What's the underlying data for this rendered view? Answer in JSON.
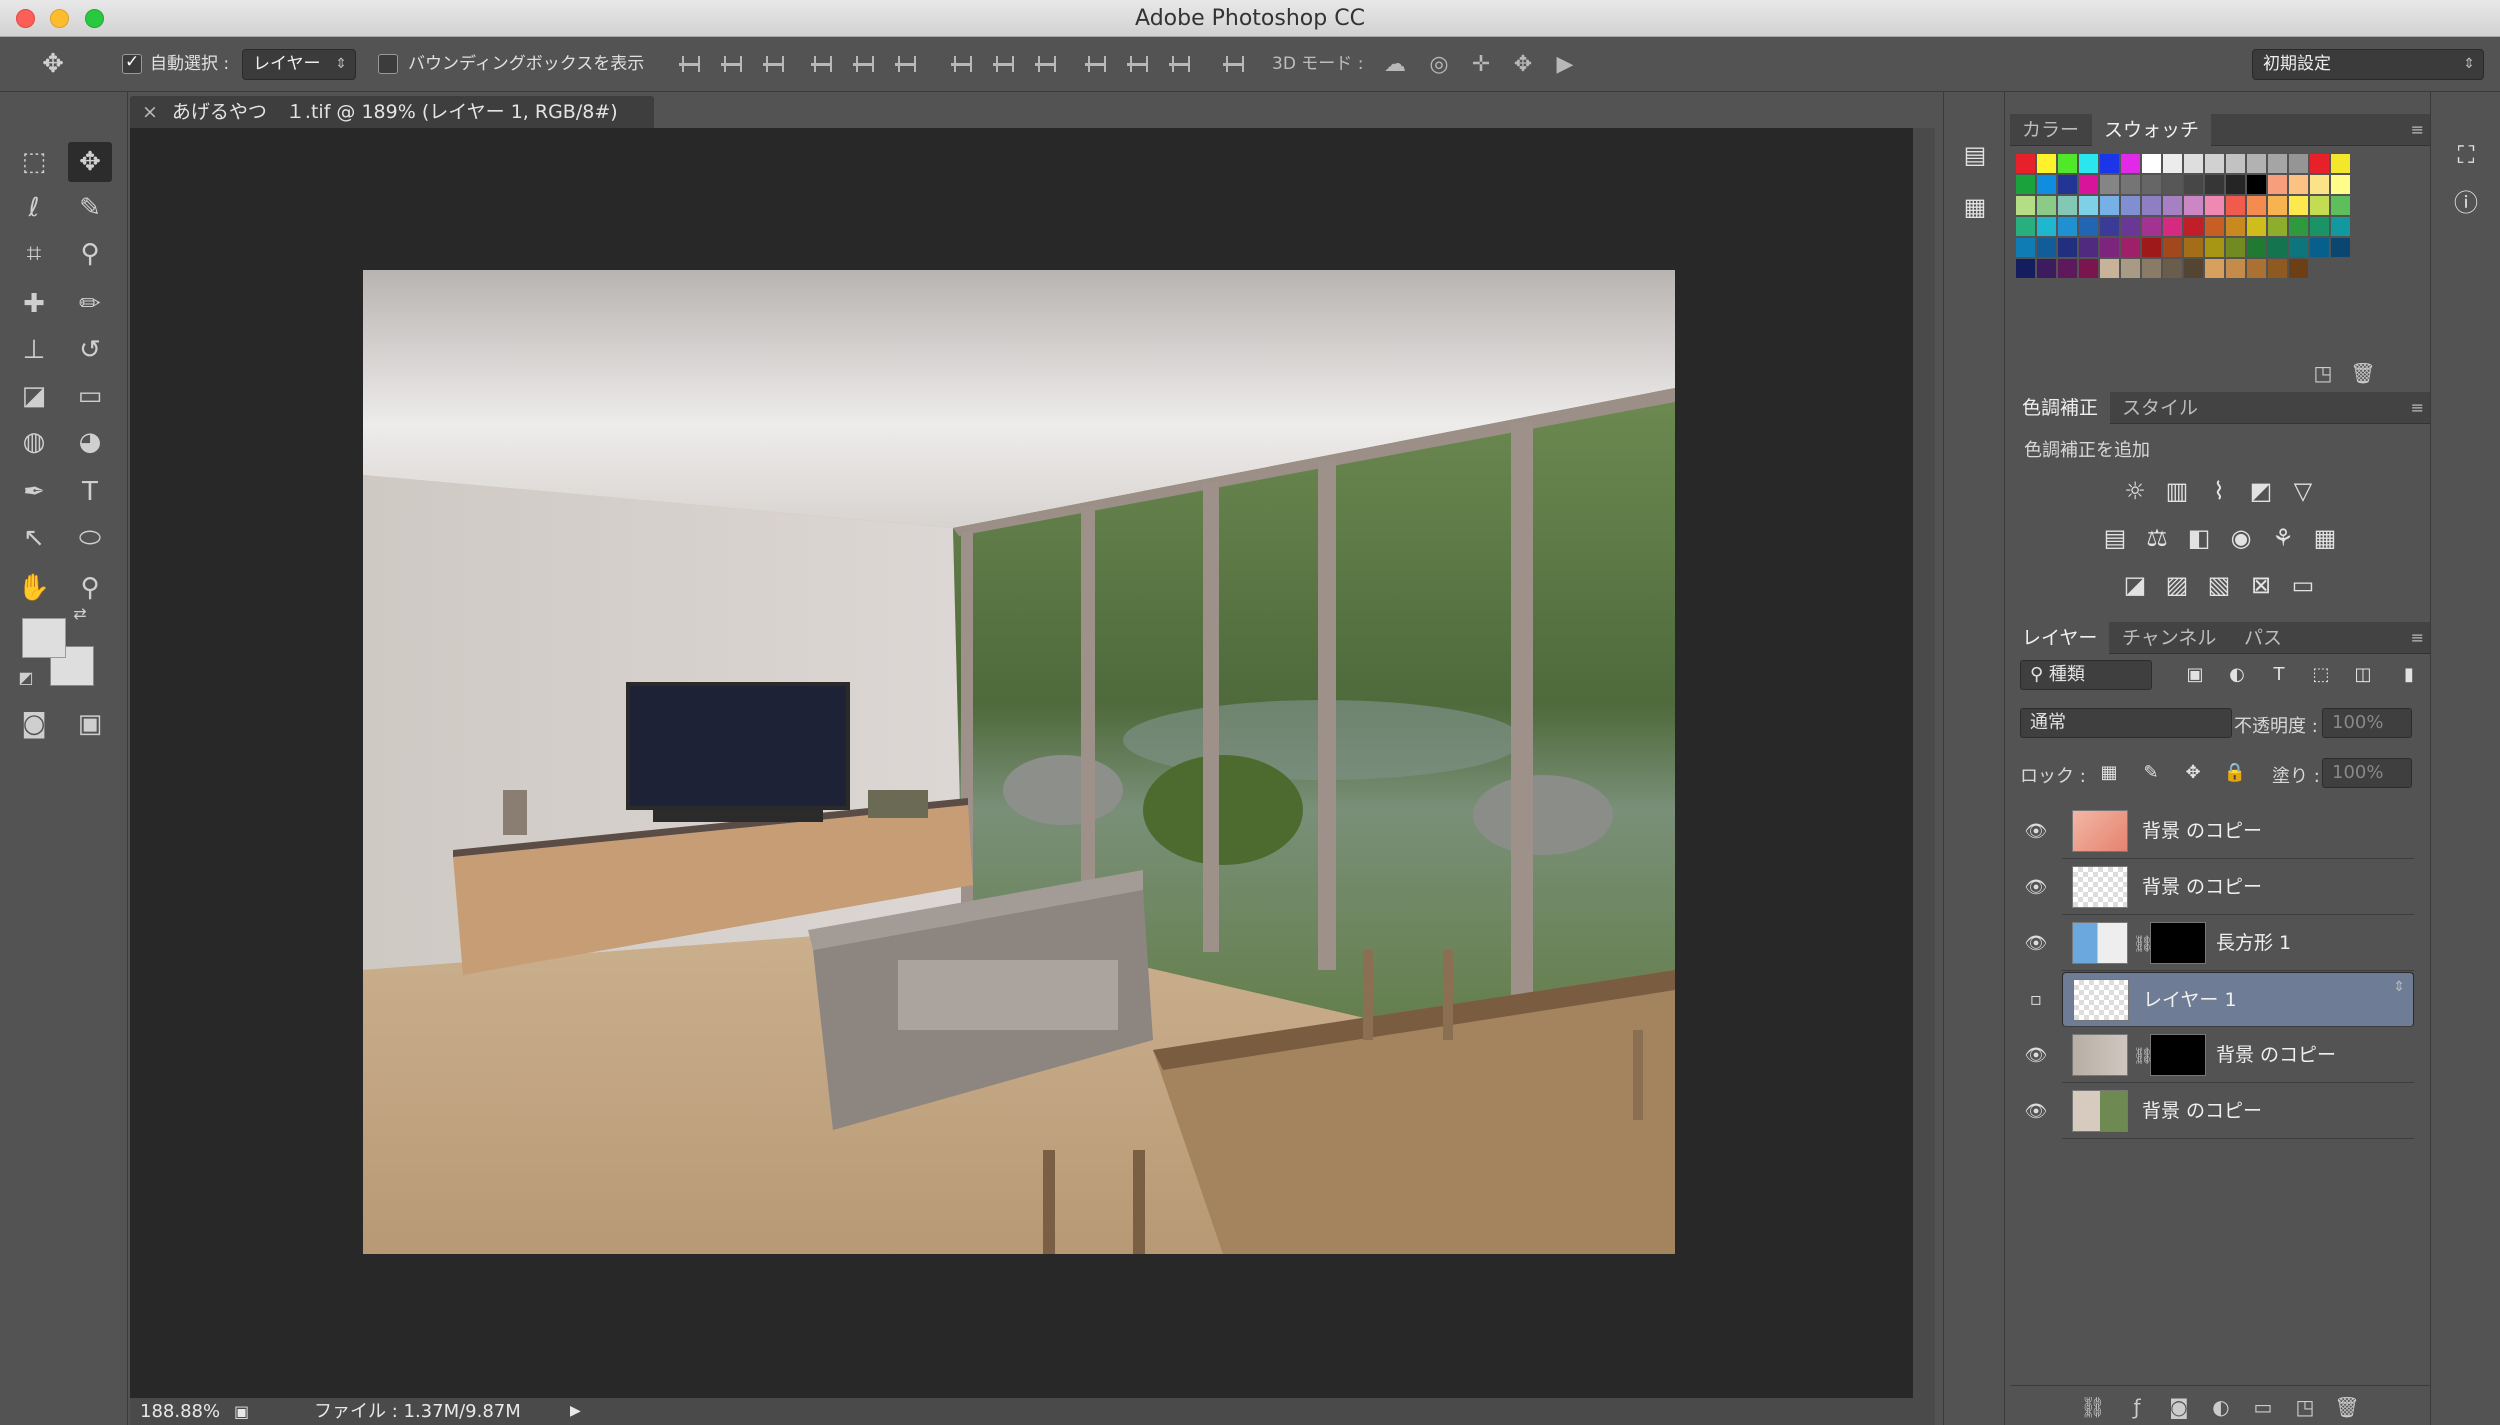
{
  "app": {
    "title": "Adobe Photoshop CC"
  },
  "options": {
    "auto_select_label": "自動選択 :",
    "auto_select_target": "レイヤー",
    "show_bbox_label": "バウンディングボックスを表示",
    "mode_3d_label": "3D モード :",
    "workspace": "初期設定"
  },
  "document": {
    "tab_title": "あげるやつ　１.tif @ 189% (レイヤー 1, RGB/8#)",
    "zoom": "188.88%",
    "file_info": "ファイル : 1.37M/9.87M"
  },
  "swatches_panel": {
    "tabs": [
      "カラー",
      "スウォッチ"
    ],
    "active": "スウォッチ",
    "colors": [
      [
        "#e8202a",
        "#fff22a",
        "#52e82a",
        "#29e6ef",
        "#1b36e8",
        "#e12ae8",
        "#ffffff",
        "#ececec",
        "#dedede",
        "#d1d1d1",
        "#c2c2c2",
        "#b2b2b2",
        "#a5a5a5",
        "#959595",
        "#e8202a",
        "#f3e62b"
      ],
      [
        "#1aa33c",
        "#0f8de0",
        "#223494",
        "#d8149a",
        "#858585",
        "#757575",
        "#666666",
        "#575757",
        "#474747",
        "#363636",
        "#252525",
        "#000000",
        "#f79e7c",
        "#fbc284",
        "#fde387",
        "#fffc89"
      ],
      [
        "#b4dd85",
        "#8bcb87",
        "#82c8b5",
        "#7ed0e6",
        "#77b0e6",
        "#7f8fd1",
        "#8e7ec2",
        "#a680c2",
        "#cc86c5",
        "#ef89b2",
        "#f05b4d",
        "#f58b4e",
        "#f6b34f",
        "#fbe94d",
        "#c2dd51",
        "#5fbe5c"
      ],
      [
        "#27b07d",
        "#1fb7d0",
        "#1f90d2",
        "#2265b2",
        "#3a3b97",
        "#6b3797",
        "#a33392",
        "#d62a80",
        "#c01e28",
        "#c75e23",
        "#c9891f",
        "#cfbd1b",
        "#8ead2c",
        "#2e9a3d",
        "#1a9467",
        "#12999f"
      ],
      [
        "#0f7cb3",
        "#135c9a",
        "#222f7e",
        "#4f2a7f",
        "#7d257c",
        "#a01f69",
        "#9e1a1a",
        "#a3481c",
        "#a46e18",
        "#a79613",
        "#728a22",
        "#207a31",
        "#13744f",
        "#0c767c",
        "#075f8b",
        "#0a466f"
      ],
      [
        "#141e5e",
        "#3c1c5e",
        "#5e185c",
        "#7a154d",
        "#c8b39a",
        "#a99a85",
        "#8a7b66",
        "#6b5d4b",
        "#544532",
        "#d7a05f",
        "#c58b4a",
        "#ab7133",
        "#8f5a22",
        "#6c4014"
      ]
    ]
  },
  "adjustments_panel": {
    "tabs": [
      "色調補正",
      "スタイル"
    ],
    "active": "色調補正",
    "heading": "色調補正を追加",
    "rows": [
      [
        "brightness-icon",
        "levels-icon",
        "curves-icon",
        "exposure-icon",
        "vibrance-icon"
      ],
      [
        "hue-saturation-icon",
        "color-balance-icon",
        "black-white-icon",
        "photo-filter-icon",
        "channel-mixer-icon",
        "color-lookup-icon"
      ],
      [
        "invert-icon",
        "posterize-icon",
        "threshold-icon",
        "selective-color-icon",
        "gradient-map-icon"
      ]
    ]
  },
  "layers_panel": {
    "tabs": [
      "レイヤー",
      "チャンネル",
      "パス"
    ],
    "active": "レイヤー",
    "filter_kind": "種類",
    "blend_mode": "通常",
    "opacity_label": "不透明度 :",
    "opacity_value": "100%",
    "lock_label": "ロック :",
    "fill_label": "塗り :",
    "fill_value": "100%",
    "layers": [
      {
        "name": "背景 のコピー",
        "visible": true,
        "selected": false,
        "mask": false
      },
      {
        "name": "背景 のコピー",
        "visible": true,
        "selected": false,
        "mask": false
      },
      {
        "name": "長方形 1",
        "visible": true,
        "selected": false,
        "mask": true
      },
      {
        "name": "レイヤー 1",
        "visible": false,
        "selected": true,
        "mask": false
      },
      {
        "name": "背景 のコピー",
        "visible": true,
        "selected": false,
        "mask": true
      },
      {
        "name": "背景 のコピー",
        "visible": true,
        "selected": false,
        "mask": false
      }
    ]
  }
}
